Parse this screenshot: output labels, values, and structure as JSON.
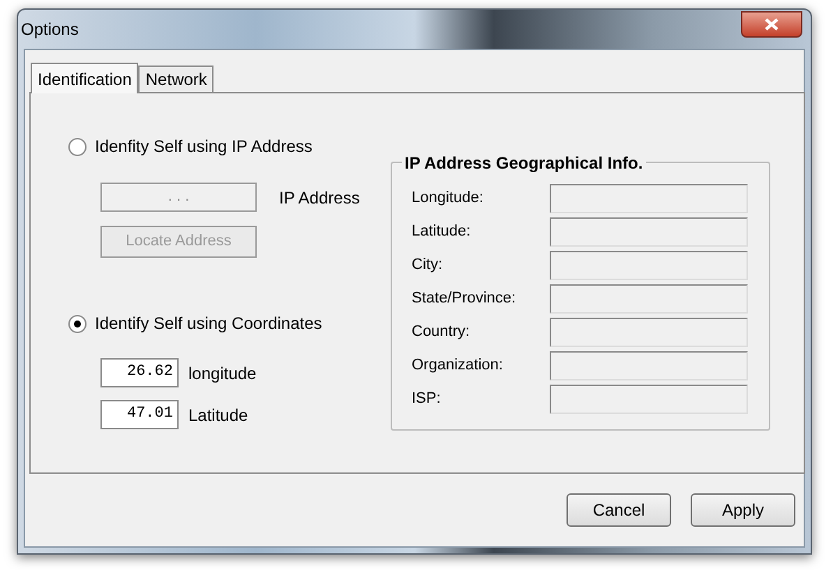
{
  "window": {
    "title": "Options"
  },
  "tabs": [
    {
      "label": "Identification",
      "selected": true
    },
    {
      "label": "Network",
      "selected": false
    }
  ],
  "ip_option": {
    "label": "Idenfity Self using IP Address",
    "selected": false,
    "ip_field": {
      "value": ".   .   .",
      "disabled": true
    },
    "ip_label": "IP Address",
    "locate_button": {
      "label": "Locate Address",
      "disabled": true
    }
  },
  "coord_option": {
    "label": "Identify Self using Coordinates",
    "selected": true,
    "fields": [
      {
        "value": "26.62",
        "label": "longitude"
      },
      {
        "value": "47.01",
        "label": "Latitude"
      }
    ]
  },
  "geo_info": {
    "title": "IP Address Geographical Info.",
    "fields": [
      {
        "label": "Longitude:"
      },
      {
        "label": "Latitude:"
      },
      {
        "label": "City:"
      },
      {
        "label": "State/Province:"
      },
      {
        "label": "Country:"
      },
      {
        "label": "Organization:"
      },
      {
        "label": "ISP:"
      }
    ]
  },
  "buttons": [
    {
      "label": "Cancel"
    },
    {
      "label": "Apply"
    }
  ]
}
